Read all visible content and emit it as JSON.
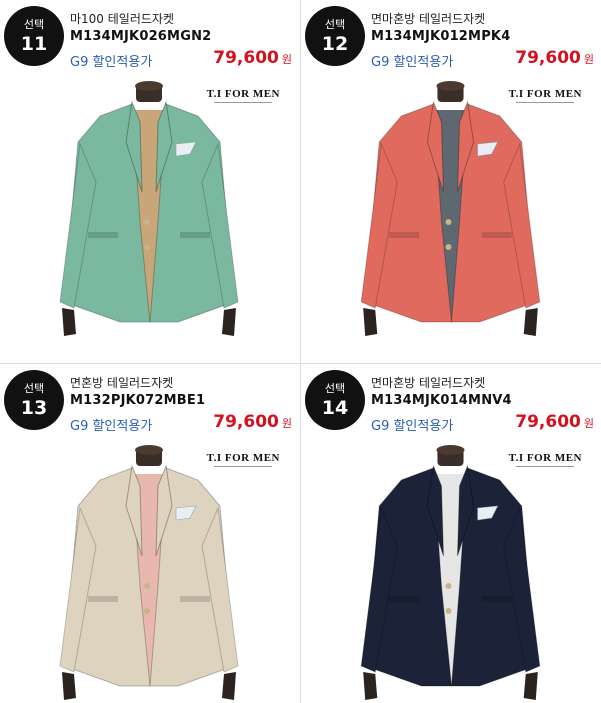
{
  "products": [
    {
      "badge_label": "선택",
      "badge_number": "11",
      "name": "마100 테일러드자켓",
      "code": "M134MJK026MGN2",
      "discount_label": "G9 할인적용가",
      "price": "79,600",
      "currency": "원",
      "brand": "T.I FOR MEN",
      "jacket_color": "#7bb8a0",
      "inner_color": "#c9a679"
    },
    {
      "badge_label": "선택",
      "badge_number": "12",
      "name": "면마혼방 테일러드자켓",
      "code": "M134MJK012MPK4",
      "discount_label": "G9 할인적용가",
      "price": "79,600",
      "currency": "원",
      "brand": "T.I FOR MEN",
      "jacket_color": "#e06a5e",
      "inner_color": "#5e6870"
    },
    {
      "badge_label": "선택",
      "badge_number": "13",
      "name": "면혼방 테일러드자켓",
      "code": "M132PJK072MBE1",
      "discount_label": "G9 할인적용가",
      "price": "79,600",
      "currency": "원",
      "brand": "T.I FOR MEN",
      "jacket_color": "#ddd3bf",
      "inner_color": "#e8b8ae"
    },
    {
      "badge_label": "선택",
      "badge_number": "14",
      "name": "면마혼방 테일러드자켓",
      "code": "M134MJK014MNV4",
      "discount_label": "G9 할인적용가",
      "price": "79,600",
      "currency": "원",
      "brand": "T.I FOR MEN",
      "jacket_color": "#1c2238",
      "inner_color": "#e6e6e6"
    }
  ]
}
